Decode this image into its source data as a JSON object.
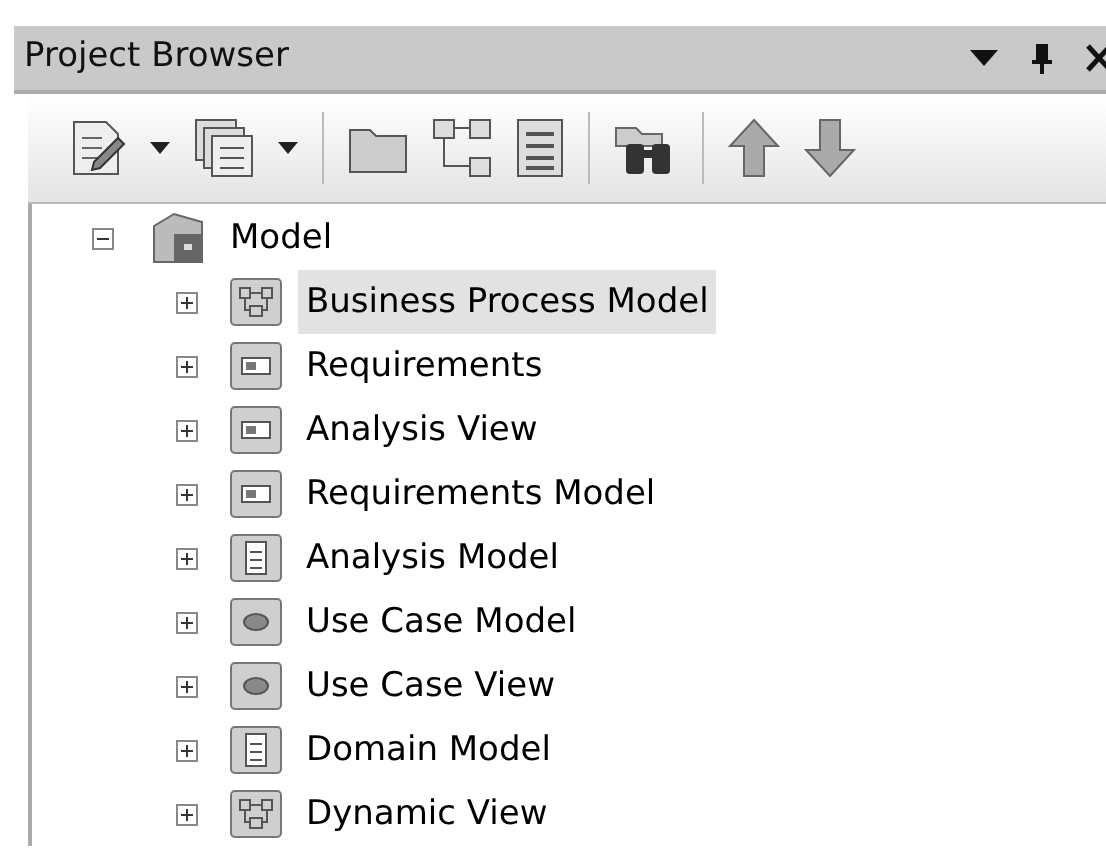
{
  "panel": {
    "title": "Project Browser"
  },
  "tree": [
    {
      "label": "Model",
      "kind": "root",
      "expanded": true,
      "selected": false,
      "children": [
        {
          "label": "Business Process Model",
          "kind": "diagram",
          "expanded": false,
          "selected": true
        },
        {
          "label": "Requirements",
          "kind": "package",
          "expanded": false,
          "selected": false
        },
        {
          "label": "Analysis View",
          "kind": "package",
          "expanded": false,
          "selected": false
        },
        {
          "label": "Requirements Model",
          "kind": "package",
          "expanded": false,
          "selected": false
        },
        {
          "label": "Analysis Model",
          "kind": "list",
          "expanded": false,
          "selected": false
        },
        {
          "label": "Use Case Model",
          "kind": "usecase",
          "expanded": false,
          "selected": false
        },
        {
          "label": "Use Case View",
          "kind": "usecase",
          "expanded": false,
          "selected": false
        },
        {
          "label": "Domain Model",
          "kind": "list",
          "expanded": false,
          "selected": false
        },
        {
          "label": "Dynamic View",
          "kind": "diagram",
          "expanded": false,
          "selected": false
        }
      ]
    }
  ]
}
